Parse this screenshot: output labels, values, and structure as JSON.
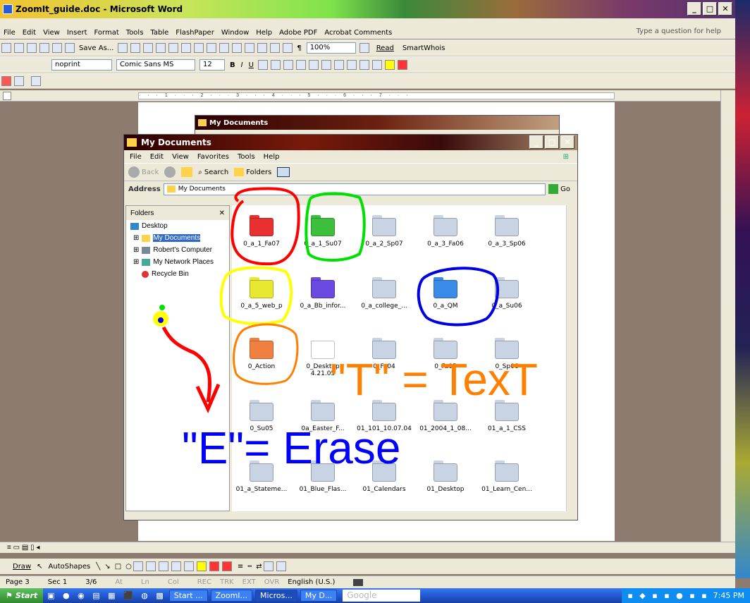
{
  "word": {
    "title": "ZoomIt_guide.doc - Microsoft Word",
    "menu": [
      "File",
      "Edit",
      "View",
      "Insert",
      "Format",
      "Tools",
      "Table",
      "FlashPaper",
      "Window",
      "Help",
      "Adobe PDF",
      "Acrobat Comments"
    ],
    "help_placeholder": "Type a question for help",
    "toolbar1": {
      "save_as": "Save As...",
      "zoom": "100%",
      "read": "Read",
      "smartwhois": "SmartWhois"
    },
    "toolbar2": {
      "style": "noprint",
      "font": "Comic Sans MS",
      "size": "12"
    },
    "drawbar": {
      "draw": "Draw",
      "autoshapes": "AutoShapes"
    },
    "status": {
      "page": "Page 3",
      "sec": "Sec 1",
      "pos": "3/6",
      "at": "At",
      "ln": "Ln",
      "col": "Col",
      "rec": "REC",
      "trk": "TRK",
      "ext": "EXT",
      "ovr": "OVR",
      "lang": "English (U.S.)"
    }
  },
  "explorer_back": {
    "title": "My Documents"
  },
  "explorer": {
    "title": "My Documents",
    "menu": [
      "File",
      "Edit",
      "View",
      "Favorites",
      "Tools",
      "Help"
    ],
    "back": "Back",
    "search": "Search",
    "folders": "Folders",
    "address_label": "Address",
    "address": "My Documents",
    "go": "Go",
    "folders_pane_title": "Folders",
    "tree": [
      "Desktop",
      "My Documents",
      "Robert's Computer",
      "My Network Places",
      "Recycle Bin"
    ],
    "files": [
      {
        "name": "0_a_1_Fa07",
        "color": "#e83030"
      },
      {
        "name": "0_a_1_Su07",
        "color": "#3cc03c"
      },
      {
        "name": "0_a_2_Sp07",
        "color": "#c8d4e4"
      },
      {
        "name": "0_a_3_Fa06",
        "color": "#c8d4e4"
      },
      {
        "name": "0_a_3_Sp06",
        "color": "#c8d4e4"
      },
      {
        "name": "0_a_5_web_p",
        "color": "#e8e830"
      },
      {
        "name": "0_a_Bb_infor...",
        "color": "#6a4ae0"
      },
      {
        "name": "0_a_college_...",
        "color": "#c8d4e4"
      },
      {
        "name": "0_a_QM",
        "color": "#3a8ae8"
      },
      {
        "name": "0_a_Su06",
        "color": "#c8d4e4"
      },
      {
        "name": "0_Action",
        "color": "#f08040"
      },
      {
        "name": "0_Desktop 4.21.05",
        "color": "#ffffff"
      },
      {
        "name": "0_Fa04",
        "color": "#c8d4e4"
      },
      {
        "name": "0_Fa05",
        "color": "#c8d4e4"
      },
      {
        "name": "0_Sp06",
        "color": "#c8d4e4"
      },
      {
        "name": "0_Su05",
        "color": "#c8d4e4"
      },
      {
        "name": "0a_Easter_F...",
        "color": "#c8d4e4"
      },
      {
        "name": "01_101_10.07.04",
        "color": "#c8d4e4"
      },
      {
        "name": "01_2004_1_08...",
        "color": "#c8d4e4"
      },
      {
        "name": "01_a_1_CSS",
        "color": "#c8d4e4"
      },
      {
        "name": "01_a_Stateme...",
        "color": "#c8d4e4"
      },
      {
        "name": "01_Blue_Flas...",
        "color": "#c8d4e4"
      },
      {
        "name": "01_Calendars",
        "color": "#c8d4e4"
      },
      {
        "name": "01_Desktop",
        "color": "#c8d4e4"
      },
      {
        "name": "01_Learn_Cen...",
        "color": "#c8d4e4"
      }
    ]
  },
  "annotations": {
    "text_label": "\"T\" = TexT",
    "erase_label": "\"E\"= Erase",
    "text_color": "#ff8000",
    "erase_color": "#0000ff"
  },
  "taskbar": {
    "start": "Start",
    "tasks": [
      "Start ...",
      "ZoomI...",
      "Micros...",
      "My D..."
    ],
    "search": "Google",
    "time": "7:45 PM"
  }
}
